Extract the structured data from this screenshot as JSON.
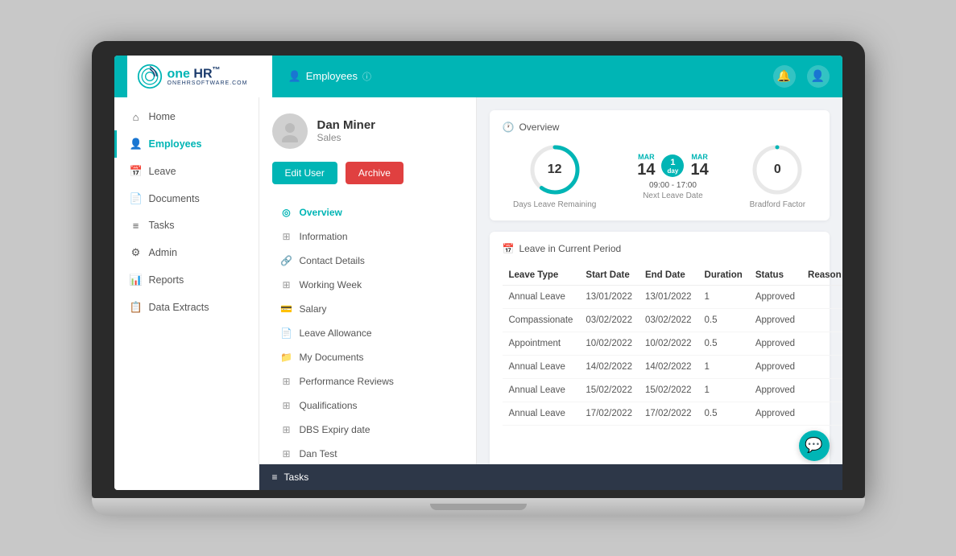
{
  "app": {
    "name": "one HR",
    "tagline": "ONEHRSOFTWARE.COM"
  },
  "topnav": {
    "breadcrumb": "Employees",
    "breadcrumb_icon": "👤"
  },
  "sidebar": {
    "items": [
      {
        "id": "home",
        "label": "Home",
        "icon": "⌂",
        "active": false
      },
      {
        "id": "employees",
        "label": "Employees",
        "icon": "👤",
        "active": true
      },
      {
        "id": "leave",
        "label": "Leave",
        "icon": "📅",
        "active": false
      },
      {
        "id": "documents",
        "label": "Documents",
        "icon": "📄",
        "active": false
      },
      {
        "id": "tasks",
        "label": "Tasks",
        "icon": "≡",
        "active": false
      },
      {
        "id": "admin",
        "label": "Admin",
        "icon": "⚙",
        "active": false
      },
      {
        "id": "reports",
        "label": "Reports",
        "icon": "📊",
        "active": false
      },
      {
        "id": "data-extracts",
        "label": "Data Extracts",
        "icon": "📋",
        "active": false
      }
    ]
  },
  "employee": {
    "name": "Dan Miner",
    "role": "Sales",
    "edit_label": "Edit User",
    "archive_label": "Archive"
  },
  "emp_nav": [
    {
      "id": "overview",
      "label": "Overview",
      "icon": "○",
      "active": true
    },
    {
      "id": "information",
      "label": "Information",
      "icon": "▦",
      "active": false
    },
    {
      "id": "contact-details",
      "label": "Contact Details",
      "icon": "🔗",
      "active": false
    },
    {
      "id": "working-week",
      "label": "Working Week",
      "icon": "▦",
      "active": false
    },
    {
      "id": "salary",
      "label": "Salary",
      "icon": "💳",
      "active": false
    },
    {
      "id": "leave-allowance",
      "label": "Leave Allowance",
      "icon": "📄",
      "active": false
    },
    {
      "id": "my-documents",
      "label": "My Documents",
      "icon": "📁",
      "active": false
    },
    {
      "id": "performance-reviews",
      "label": "Performance Reviews",
      "icon": "▦",
      "active": false
    },
    {
      "id": "qualifications",
      "label": "Qualifications",
      "icon": "▦",
      "active": false
    },
    {
      "id": "dbs-expiry",
      "label": "DBS Expiry date",
      "icon": "▦",
      "active": false
    },
    {
      "id": "dan-test",
      "label": "Dan Test",
      "icon": "▦",
      "active": false
    }
  ],
  "overview": {
    "title": "Overview",
    "stats": {
      "days_leave": {
        "value": 12,
        "label": "Days Leave Remaining",
        "percent": 60
      },
      "next_leave": {
        "from_month": "MAR",
        "from_day": "14",
        "badge_num": "1",
        "badge_text": "day",
        "to_month": "MAR",
        "to_day": "14",
        "time": "09:00 - 17:00",
        "label": "Next Leave Date"
      },
      "bradford": {
        "value": 0,
        "label": "Bradford Factor",
        "percent": 0
      }
    }
  },
  "leave_table": {
    "title": "Leave in Current Period",
    "columns": [
      "Leave Type",
      "Start Date",
      "End Date",
      "Duration",
      "Status",
      "Reason"
    ],
    "rows": [
      {
        "type": "Annual Leave",
        "start": "13/01/2022",
        "end": "13/01/2022",
        "duration": "1",
        "status": "Approved",
        "reason": ""
      },
      {
        "type": "Compassionate",
        "start": "03/02/2022",
        "end": "03/02/2022",
        "duration": "0.5",
        "status": "Approved",
        "reason": ""
      },
      {
        "type": "Appointment",
        "start": "10/02/2022",
        "end": "10/02/2022",
        "duration": "0.5",
        "status": "Approved",
        "reason": ""
      },
      {
        "type": "Annual Leave",
        "start": "14/02/2022",
        "end": "14/02/2022",
        "duration": "1",
        "status": "Approved",
        "reason": ""
      },
      {
        "type": "Annual Leave",
        "start": "15/02/2022",
        "end": "15/02/2022",
        "duration": "1",
        "status": "Approved",
        "reason": ""
      },
      {
        "type": "Annual Leave",
        "start": "17/02/2022",
        "end": "17/02/2022",
        "duration": "0.5",
        "status": "Approved",
        "reason": ""
      }
    ]
  },
  "tasks_bar": {
    "label": "Tasks",
    "icon": "≡"
  },
  "colors": {
    "teal": "#00b5b5",
    "red": "#e04040",
    "dark": "#2d3748"
  }
}
